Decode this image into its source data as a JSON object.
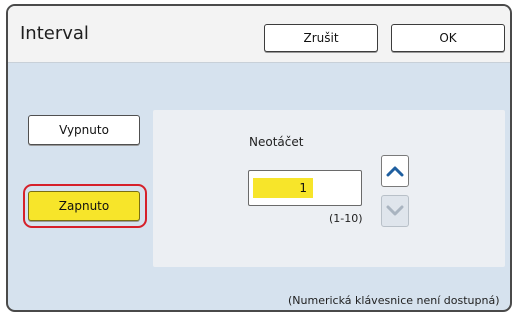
{
  "dialog": {
    "title": "Interval",
    "cancel_label": "Zrušit",
    "ok_label": "OK"
  },
  "options": {
    "off_label": "Vypnuto",
    "on_label": "Zapnuto",
    "selected": "Zapnuto"
  },
  "panel": {
    "field_label": "Neotáčet",
    "value": "1",
    "range": "(1-10)",
    "up_icon": "chevron-up-icon",
    "down_icon": "chevron-down-icon"
  },
  "footnote": "(Numerická klávesnice není dostupná)",
  "colors": {
    "selected": "#f7e52a",
    "highlight_ring": "#d6202a",
    "background": "#d6e2ee"
  }
}
